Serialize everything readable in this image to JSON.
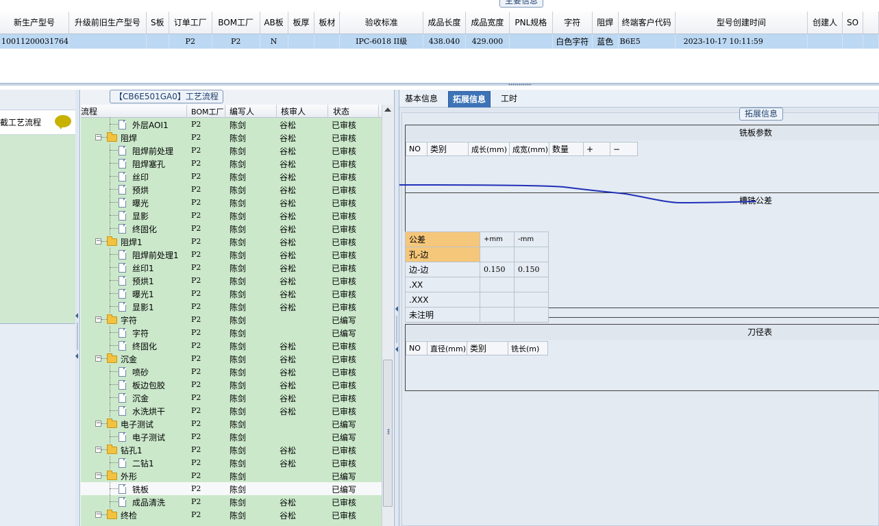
{
  "top": {
    "title": "主要信息",
    "columns": [
      "新生产型号",
      "升级前旧生产型号",
      "S板",
      "订单工厂",
      "BOM工厂",
      "AB板",
      "板厚",
      "板材",
      "验收标准",
      "成品长度",
      "成品宽度",
      "PNL规格",
      "字符",
      "阻焊",
      "终端客户代码",
      "型号创建时间",
      "创建人",
      "SO"
    ],
    "row": [
      "10011200031764",
      "",
      "",
      "P2",
      "P2",
      "N",
      "",
      "",
      "IPC-6018 II级",
      "438.040",
      "429.000",
      "",
      "白色字符",
      "蓝色",
      "B6E5",
      "2023-10-17 10:11:59",
      "",
      ""
    ]
  },
  "left_nav": {
    "item_label": "截工艺流程"
  },
  "process": {
    "title": "【CB6E501GA0】工艺流程",
    "columns": [
      "流程",
      "BOM工厂",
      "编写人",
      "核审人",
      "状态"
    ],
    "rows": [
      {
        "name": "外层AOI1",
        "bom": "P2",
        "writer": "陈剑",
        "reviewer": "谷松",
        "status": "已审核"
      },
      {
        "name": "阻焊",
        "bom": "P2",
        "writer": "陈剑",
        "reviewer": "谷松",
        "status": "已审核"
      },
      {
        "name": "阻焊前处理",
        "bom": "P2",
        "writer": "陈剑",
        "reviewer": "谷松",
        "status": "已审核"
      },
      {
        "name": "阻焊塞孔",
        "bom": "P2",
        "writer": "陈剑",
        "reviewer": "谷松",
        "status": "已审核"
      },
      {
        "name": "丝印",
        "bom": "P2",
        "writer": "陈剑",
        "reviewer": "谷松",
        "status": "已审核"
      },
      {
        "name": "预烘",
        "bom": "P2",
        "writer": "陈剑",
        "reviewer": "谷松",
        "status": "已审核"
      },
      {
        "name": "曝光",
        "bom": "P2",
        "writer": "陈剑",
        "reviewer": "谷松",
        "status": "已审核"
      },
      {
        "name": "显影",
        "bom": "P2",
        "writer": "陈剑",
        "reviewer": "谷松",
        "status": "已审核"
      },
      {
        "name": "终固化",
        "bom": "P2",
        "writer": "陈剑",
        "reviewer": "谷松",
        "status": "已审核"
      },
      {
        "name": "阻焊1",
        "bom": "P2",
        "writer": "陈剑",
        "reviewer": "谷松",
        "status": "已审核"
      },
      {
        "name": "阻焊前处理1",
        "bom": "P2",
        "writer": "陈剑",
        "reviewer": "谷松",
        "status": "已审核"
      },
      {
        "name": "丝印1",
        "bom": "P2",
        "writer": "陈剑",
        "reviewer": "谷松",
        "status": "已审核"
      },
      {
        "name": "预烘1",
        "bom": "P2",
        "writer": "陈剑",
        "reviewer": "谷松",
        "status": "已审核"
      },
      {
        "name": "曝光1",
        "bom": "P2",
        "writer": "陈剑",
        "reviewer": "谷松",
        "status": "已审核"
      },
      {
        "name": "显影1",
        "bom": "P2",
        "writer": "陈剑",
        "reviewer": "谷松",
        "status": "已审核"
      },
      {
        "name": "字符",
        "bom": "P2",
        "writer": "陈剑",
        "reviewer": "",
        "status": "已编写"
      },
      {
        "name": "字符",
        "bom": "P2",
        "writer": "陈剑",
        "reviewer": "",
        "status": "已编写"
      },
      {
        "name": "终固化",
        "bom": "P2",
        "writer": "陈剑",
        "reviewer": "谷松",
        "status": "已审核"
      },
      {
        "name": "沉金",
        "bom": "P2",
        "writer": "陈剑",
        "reviewer": "谷松",
        "status": "已审核"
      },
      {
        "name": "喷砂",
        "bom": "P2",
        "writer": "陈剑",
        "reviewer": "谷松",
        "status": "已审核"
      },
      {
        "name": "板边包胶",
        "bom": "P2",
        "writer": "陈剑",
        "reviewer": "谷松",
        "status": "已审核"
      },
      {
        "name": "沉金",
        "bom": "P2",
        "writer": "陈剑",
        "reviewer": "谷松",
        "status": "已审核"
      },
      {
        "name": "水洗烘干",
        "bom": "P2",
        "writer": "陈剑",
        "reviewer": "谷松",
        "status": "已审核"
      },
      {
        "name": "电子测试",
        "bom": "P2",
        "writer": "陈剑",
        "reviewer": "",
        "status": "已编写"
      },
      {
        "name": "电子测试",
        "bom": "P2",
        "writer": "陈剑",
        "reviewer": "",
        "status": "已编写"
      },
      {
        "name": "钻孔1",
        "bom": "P2",
        "writer": "陈剑",
        "reviewer": "谷松",
        "status": "已审核"
      },
      {
        "name": "二钻1",
        "bom": "P2",
        "writer": "陈剑",
        "reviewer": "谷松",
        "status": "已审核"
      },
      {
        "name": "外形",
        "bom": "P2",
        "writer": "陈剑",
        "reviewer": "",
        "status": "已编写"
      },
      {
        "name": "铣板",
        "bom": "P2",
        "writer": "陈剑",
        "reviewer": "",
        "status": "已编写"
      },
      {
        "name": "成品清洗",
        "bom": "P2",
        "writer": "陈剑",
        "reviewer": "谷松",
        "status": "已审核"
      },
      {
        "name": "终检",
        "bom": "P2",
        "writer": "陈剑",
        "reviewer": "谷松",
        "status": "已审核"
      }
    ]
  },
  "right": {
    "tabs": [
      "基本信息",
      "拓展信息",
      "工时"
    ],
    "ext_title": "拓展信息",
    "milling": {
      "title": "铣板参数",
      "columns": [
        "NO",
        "类别",
        "成长(mm)",
        "成宽(mm)",
        "数量",
        "+",
        "−"
      ]
    },
    "tolerance": {
      "title": "槽铣公差",
      "columns": [
        "公差",
        "+mm",
        "-mm"
      ],
      "rows": [
        {
          "label": "孔-边",
          "plus": "",
          "minus": ""
        },
        {
          "label": "边-边",
          "plus": "0.150",
          "minus": "0.150"
        },
        {
          "label": ".XX",
          "plus": "",
          "minus": ""
        },
        {
          "label": ".XXX",
          "plus": "",
          "minus": ""
        },
        {
          "label": "未注明",
          "plus": "",
          "minus": ""
        }
      ]
    },
    "tool": {
      "title": "刀径表",
      "columns": [
        "NO",
        "直径(mm)",
        "类别",
        "铣长(m)"
      ]
    }
  },
  "colors": {
    "selection": "#bcd8f3",
    "tree_row": "#cbe8cb",
    "active_tab": "#3e73b7",
    "highlight": "#f5c77a",
    "pen": "#1f2fb8"
  }
}
